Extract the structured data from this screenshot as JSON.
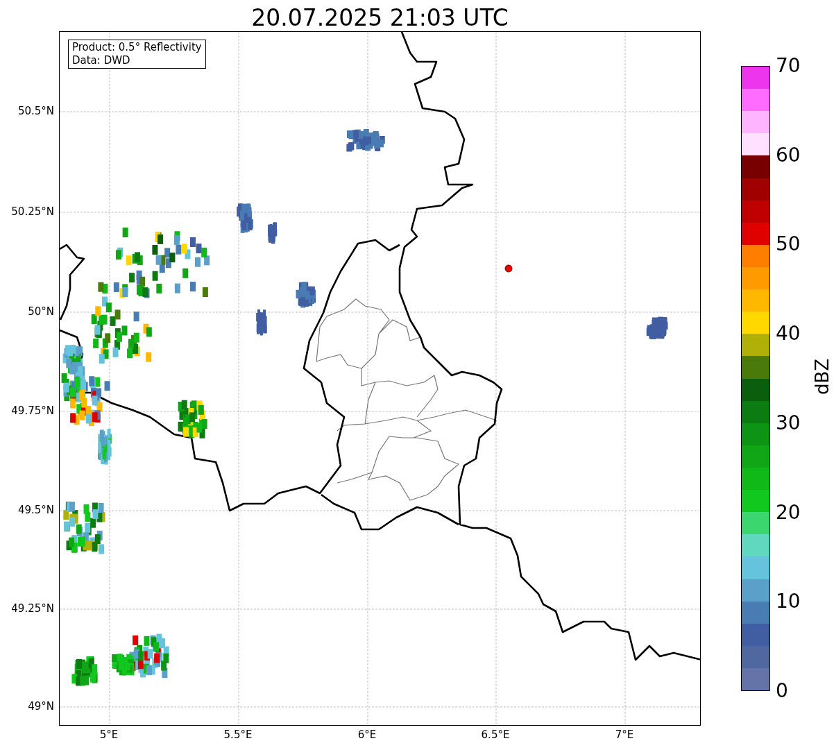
{
  "title": "20.07.2025 21:03 UTC",
  "info_box": [
    "Product: 0.5° Reflectivity",
    "Data: DWD"
  ],
  "y_ticks": [
    "50.5°N",
    "50.25°N",
    "50°N",
    "49.75°N",
    "49.5°N",
    "49.25°N",
    "49°N"
  ],
  "x_ticks": [
    "5°E",
    "5.5°E",
    "6°E",
    "6.5°E",
    "7°E"
  ],
  "colorbar": {
    "label": "dBZ",
    "ticks": [
      "70",
      "60",
      "50",
      "40",
      "30",
      "20",
      "10",
      "0"
    ],
    "bins": [
      {
        "color": "#ee35ee"
      },
      {
        "color": "#ff6cff"
      },
      {
        "color": "#ffb4ff"
      },
      {
        "color": "#ffe0ff"
      },
      {
        "color": "#780000"
      },
      {
        "color": "#a00000"
      },
      {
        "color": "#c00000"
      },
      {
        "color": "#e00000"
      },
      {
        "color": "#ff7e00"
      },
      {
        "color": "#ff9a00"
      },
      {
        "color": "#ffb800"
      },
      {
        "color": "#ffd800"
      },
      {
        "color": "#b0b008"
      },
      {
        "color": "#4a7a0a"
      },
      {
        "color": "#0a5e0c"
      },
      {
        "color": "#0c7c12"
      },
      {
        "color": "#0e9414"
      },
      {
        "color": "#10a616"
      },
      {
        "color": "#10b818"
      },
      {
        "color": "#10c81e"
      },
      {
        "color": "#3cd66e"
      },
      {
        "color": "#60d8c0"
      },
      {
        "color": "#66c3dc"
      },
      {
        "color": "#5aa0c8"
      },
      {
        "color": "#4a7cb4"
      },
      {
        "color": "#425ea2"
      },
      {
        "color": "#5068a0"
      },
      {
        "color": "#6473a8"
      }
    ]
  }
}
